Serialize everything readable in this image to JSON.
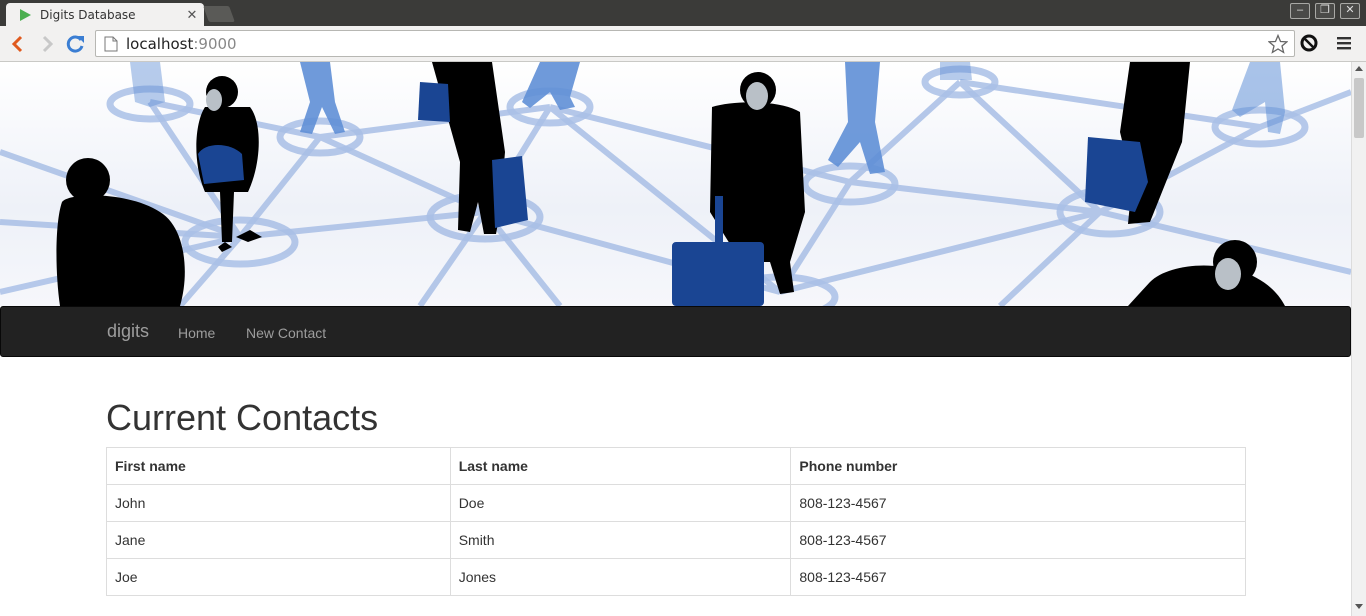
{
  "browser": {
    "tab_title": "Digits Database",
    "url_host": "localhost",
    "url_port": ":9000"
  },
  "icons": {
    "back": "back-arrow-icon",
    "forward": "forward-arrow-icon",
    "reload": "reload-icon",
    "page": "page-icon",
    "bookmark": "star-icon",
    "extension": "extension-icon",
    "menu": "hamburger-menu-icon",
    "favicon": "play-triangle-icon"
  },
  "colors": {
    "navbar_bg": "#222222",
    "navbar_text": "#9d9d9d",
    "banner_blue": "#1a4593",
    "banner_network": "#a9bfe6"
  },
  "navbar": {
    "brand": "digits",
    "links": [
      {
        "label": "Home"
      },
      {
        "label": "New Contact"
      }
    ]
  },
  "main": {
    "heading": "Current Contacts",
    "table": {
      "headers": [
        "First name",
        "Last name",
        "Phone number"
      ],
      "rows": [
        [
          "John",
          "Doe",
          "808-123-4567"
        ],
        [
          "Jane",
          "Smith",
          "808-123-4567"
        ],
        [
          "Joe",
          "Jones",
          "808-123-4567"
        ]
      ]
    }
  }
}
